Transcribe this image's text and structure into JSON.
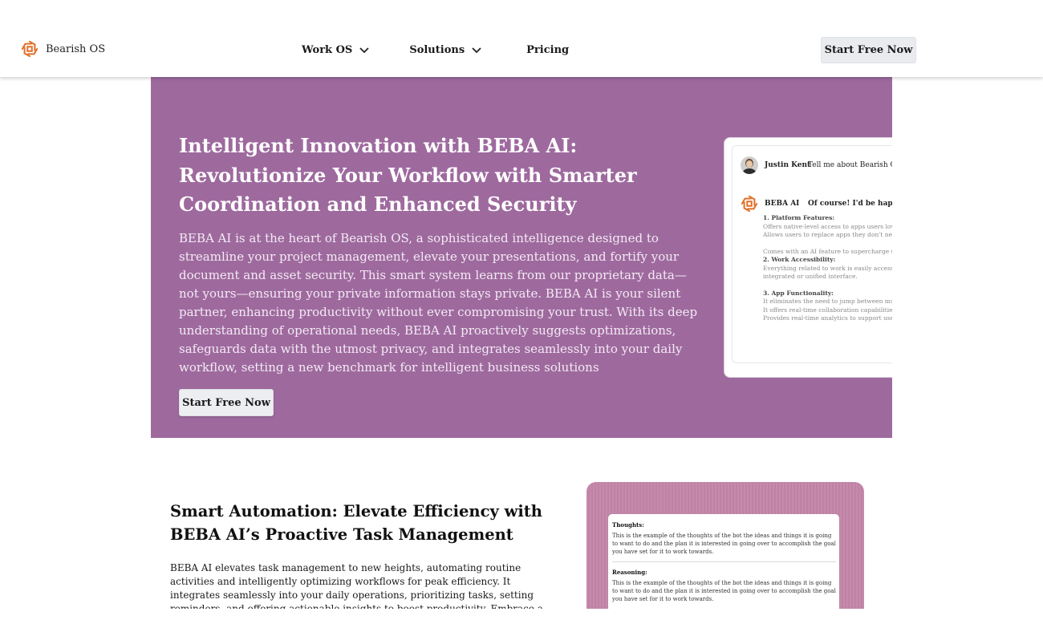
{
  "header": {
    "brand": "Bearish OS",
    "nav": [
      {
        "label": "Work OS",
        "has_dropdown": true
      },
      {
        "label": "Solutions",
        "has_dropdown": true
      },
      {
        "label": "Pricing",
        "has_dropdown": false
      }
    ],
    "cta_label": "Start Free Now"
  },
  "hero": {
    "title": "Intelligent Innovation with BEBA AI: Revolutionize Your Workflow with Smarter Coordination and Enhanced Security",
    "description": "BEBA AI is at the heart of Bearish OS, a sophisticated intelligence designed to streamline your project management, elevate your presentations, and fortify your document and asset security. This smart system learns from our proprietary data—not yours—ensuring your private information stays private. BEBA AI is your silent partner, enhancing productivity without ever compromising your trust. With its deep understanding of operational needs, BEBA AI proactively suggests optimizations, safeguards data with the utmost privacy, and integrates seamlessly into your daily workflow, setting a new benchmark for intelligent business solutions",
    "cta_label": "Start Free Now",
    "background_color": "#9e6a9e",
    "chat": {
      "user_name": "Justin Kent",
      "user_message": "Tell me about Bearish OS.",
      "ai_name": "BEBA AI",
      "ai_message": "Of course! I'd be happy to",
      "sections": [
        {
          "heading": "1. Platform Features:",
          "lines": [
            "Offers native-level access to apps users love.",
            "Allows users to replace apps they don't need.",
            "",
            "Comes with an AI feature to supercharge user"
          ]
        },
        {
          "heading": "2. Work Accessibility:",
          "lines": [
            "Everything related to work is easily accessible",
            "integrated or unified interface."
          ]
        },
        {
          "heading": "3. App Functionality:",
          "lines": [
            "It eliminates the need to jump between multip",
            "It offers real-time collaboration capabilities.",
            "Provides real-time analytics to support user su"
          ]
        }
      ]
    }
  },
  "section2": {
    "title": "Smart Automation: Elevate Efficiency with BEBA AI’s Proactive Task Management",
    "description": "BEBA AI elevates task management to new heights, automating routine activities and intelligently optimizing workflows for peak efficiency. It integrates seamlessly into your daily operations, prioritizing tasks, setting reminders, and offering actionable insights to boost productivity. Embrace a smarter workday with BEBA AI’s proactive, efficiency",
    "card": {
      "thoughts_label": "Thoughts:",
      "thoughts_text": "This is the example of the thoughts of the bot the ideas and things it is going to want to do and the plan it is interested in going over to accomplish the goal you have set for it to work towards.",
      "reasoning_label": "Reasoning:",
      "reasoning_text": "This is the example of the thoughts of the bot the ideas and things it is going to want to do and the plan it is interested in going over to accomplish the goal you have set for it to work towards."
    }
  },
  "colors": {
    "brand_orange": "#e0702a",
    "hero_purple": "#9e6a9e",
    "card_pink": "#c58aac"
  }
}
